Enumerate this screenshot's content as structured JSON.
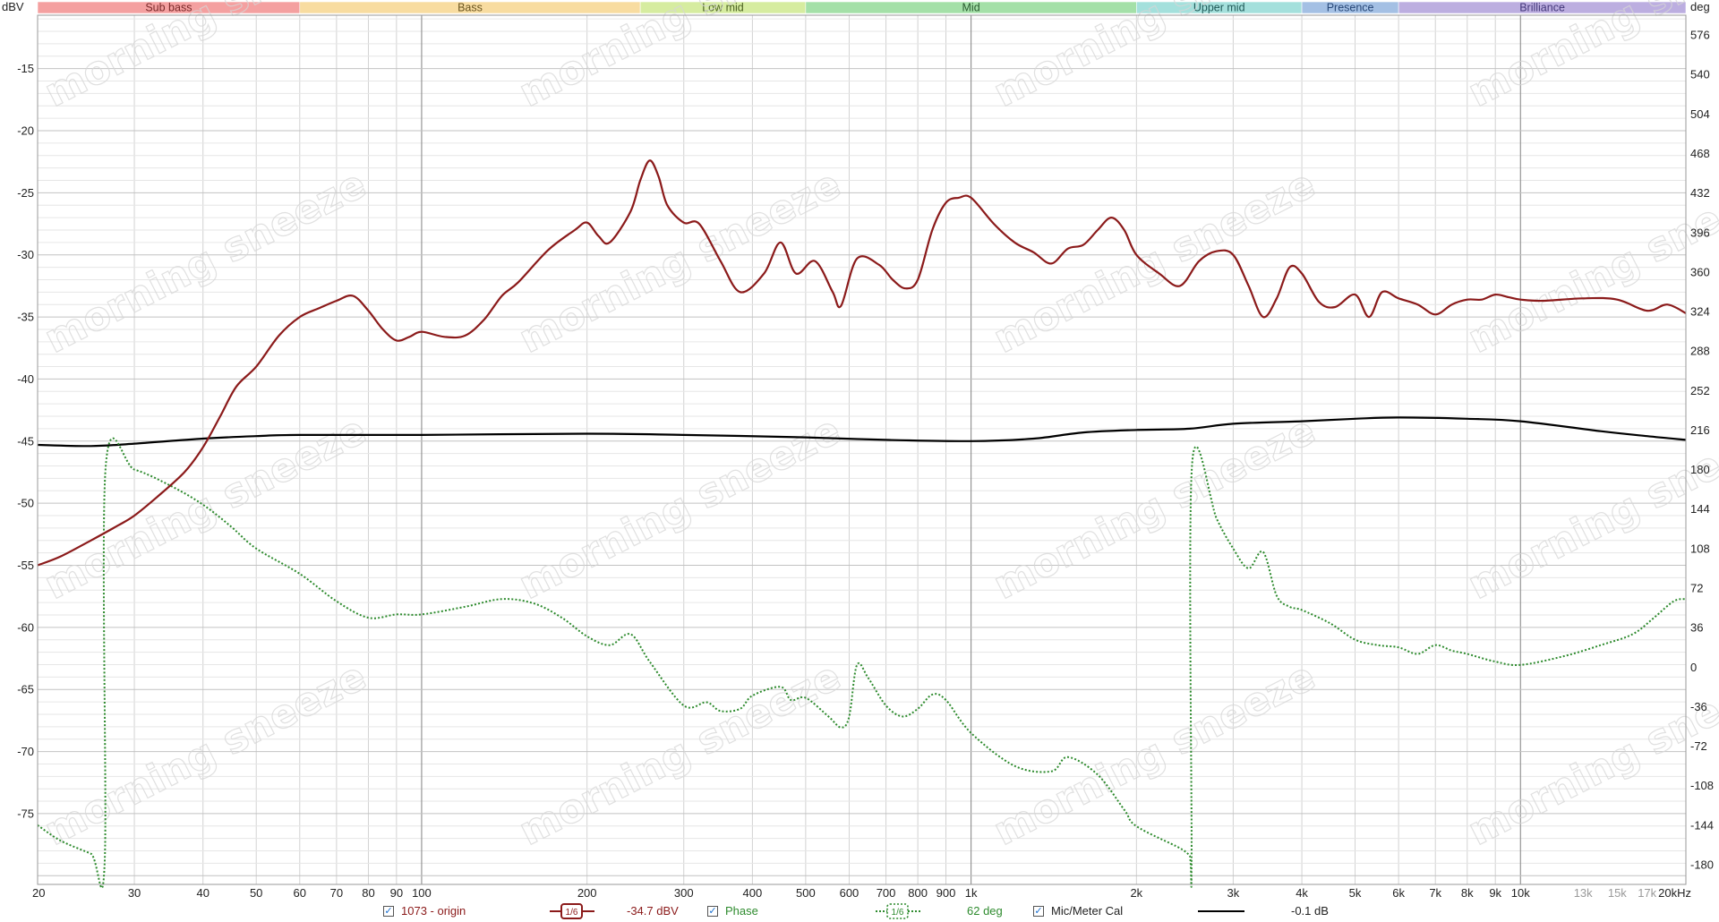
{
  "chart_data": {
    "type": "line",
    "x_scale": "log",
    "xlim": [
      20,
      20000
    ],
    "y_left": {
      "unit_label": "dBV",
      "lim": [
        -80.7,
        -10.7
      ],
      "ticks": [
        -15,
        -20,
        -25,
        -30,
        -35,
        -40,
        -45,
        -50,
        -55,
        -60,
        -65,
        -70,
        -75
      ]
    },
    "y_right": {
      "unit_label": "deg",
      "lim": [
        -198,
        594
      ],
      "ticks": [
        576,
        540,
        504,
        468,
        432,
        396,
        360,
        324,
        288,
        252,
        216,
        180,
        144,
        108,
        72,
        36,
        0,
        -36,
        -72,
        -108,
        -144,
        -180
      ]
    },
    "x_ticks_major": [
      {
        "v": 20,
        "t": "20"
      },
      {
        "v": 30,
        "t": "30"
      },
      {
        "v": 40,
        "t": "40"
      },
      {
        "v": 50,
        "t": "50"
      },
      {
        "v": 60,
        "t": "60"
      },
      {
        "v": 70,
        "t": "70"
      },
      {
        "v": 80,
        "t": "80"
      },
      {
        "v": 90,
        "t": "90"
      },
      {
        "v": 100,
        "t": "100"
      },
      {
        "v": 200,
        "t": "200"
      },
      {
        "v": 300,
        "t": "300"
      },
      {
        "v": 400,
        "t": "400"
      },
      {
        "v": 500,
        "t": "500"
      },
      {
        "v": 600,
        "t": "600"
      },
      {
        "v": 700,
        "t": "700"
      },
      {
        "v": 800,
        "t": "800"
      },
      {
        "v": 900,
        "t": "900"
      },
      {
        "v": 1000,
        "t": "1k"
      },
      {
        "v": 2000,
        "t": "2k"
      },
      {
        "v": 3000,
        "t": "3k"
      },
      {
        "v": 4000,
        "t": "4k"
      },
      {
        "v": 5000,
        "t": "5k"
      },
      {
        "v": 6000,
        "t": "6k"
      },
      {
        "v": 7000,
        "t": "7k"
      },
      {
        "v": 8000,
        "t": "8k"
      },
      {
        "v": 9000,
        "t": "9k"
      },
      {
        "v": 10000,
        "t": "10k"
      },
      {
        "v": 20000,
        "t": "20kHz"
      }
    ],
    "x_ticks_minor": [
      {
        "v": 13000,
        "t": "13k"
      },
      {
        "v": 15000,
        "t": "15k"
      },
      {
        "v": 17000,
        "t": "17k"
      }
    ],
    "bands": [
      {
        "name": "Sub bass",
        "from": 20,
        "to": 60,
        "color": "#f4a0a0",
        "text": "#7a2a2a"
      },
      {
        "name": "Bass",
        "from": 60,
        "to": 250,
        "color": "#f8dca0",
        "text": "#6a5520"
      },
      {
        "name": "Low mid",
        "from": 250,
        "to": 500,
        "color": "#d6eca0",
        "text": "#4a6020"
      },
      {
        "name": "Mid",
        "from": 500,
        "to": 2000,
        "color": "#a4e0a8",
        "text": "#2a5a30"
      },
      {
        "name": "Upper mid",
        "from": 2000,
        "to": 4000,
        "color": "#a4e0dc",
        "text": "#205a58"
      },
      {
        "name": "Presence",
        "from": 4000,
        "to": 6000,
        "color": "#a4c0e4",
        "text": "#284878"
      },
      {
        "name": "Brilliance",
        "from": 6000,
        "to": 20000,
        "color": "#bcaee0",
        "text": "#44387a"
      }
    ],
    "series": [
      {
        "name": "1073 - origin",
        "axis": "left",
        "color": "#8b1a1a",
        "style": "solid",
        "points": [
          [
            20,
            -55
          ],
          [
            22,
            -54.3
          ],
          [
            25,
            -53
          ],
          [
            28,
            -51.8
          ],
          [
            30,
            -51
          ],
          [
            33,
            -49.5
          ],
          [
            37,
            -47.5
          ],
          [
            40,
            -45.5
          ],
          [
            43,
            -43
          ],
          [
            46,
            -40.6
          ],
          [
            50,
            -39
          ],
          [
            55,
            -36.5
          ],
          [
            60,
            -35
          ],
          [
            65,
            -34.3
          ],
          [
            70,
            -33.7
          ],
          [
            75,
            -33.3
          ],
          [
            80,
            -34.5
          ],
          [
            85,
            -36
          ],
          [
            90,
            -36.9
          ],
          [
            95,
            -36.6
          ],
          [
            100,
            -36.2
          ],
          [
            110,
            -36.6
          ],
          [
            120,
            -36.5
          ],
          [
            130,
            -35.2
          ],
          [
            140,
            -33.3
          ],
          [
            150,
            -32.2
          ],
          [
            170,
            -29.6
          ],
          [
            190,
            -28
          ],
          [
            200,
            -27.4
          ],
          [
            210,
            -28.5
          ],
          [
            220,
            -29
          ],
          [
            240,
            -26.5
          ],
          [
            250,
            -24
          ],
          [
            260,
            -22.4
          ],
          [
            270,
            -23.7
          ],
          [
            280,
            -26
          ],
          [
            300,
            -27.4
          ],
          [
            320,
            -27.5
          ],
          [
            350,
            -30.5
          ],
          [
            380,
            -33
          ],
          [
            420,
            -31.5
          ],
          [
            450,
            -29
          ],
          [
            480,
            -31.5
          ],
          [
            520,
            -30.5
          ],
          [
            560,
            -33
          ],
          [
            580,
            -34.1
          ],
          [
            620,
            -30.3
          ],
          [
            680,
            -30.8
          ],
          [
            720,
            -32
          ],
          [
            760,
            -32.7
          ],
          [
            800,
            -32
          ],
          [
            850,
            -28
          ],
          [
            900,
            -25.8
          ],
          [
            950,
            -25.4
          ],
          [
            1000,
            -25.4
          ],
          [
            1100,
            -27.5
          ],
          [
            1200,
            -29
          ],
          [
            1300,
            -29.8
          ],
          [
            1400,
            -30.7
          ],
          [
            1500,
            -29.5
          ],
          [
            1600,
            -29.2
          ],
          [
            1700,
            -28
          ],
          [
            1800,
            -27
          ],
          [
            1900,
            -28
          ],
          [
            2000,
            -30
          ],
          [
            2200,
            -31.5
          ],
          [
            2400,
            -32.5
          ],
          [
            2600,
            -30.5
          ],
          [
            2800,
            -29.7
          ],
          [
            3000,
            -30
          ],
          [
            3200,
            -32.5
          ],
          [
            3400,
            -35
          ],
          [
            3600,
            -33.5
          ],
          [
            3800,
            -31
          ],
          [
            4000,
            -31.5
          ],
          [
            4300,
            -33.8
          ],
          [
            4600,
            -34.2
          ],
          [
            5000,
            -33.2
          ],
          [
            5300,
            -35
          ],
          [
            5600,
            -33
          ],
          [
            6000,
            -33.5
          ],
          [
            6500,
            -34
          ],
          [
            7000,
            -34.8
          ],
          [
            7500,
            -34
          ],
          [
            8000,
            -33.6
          ],
          [
            8500,
            -33.6
          ],
          [
            9000,
            -33.2
          ],
          [
            9500,
            -33.4
          ],
          [
            10000,
            -33.6
          ],
          [
            11000,
            -33.7
          ],
          [
            13000,
            -33.5
          ],
          [
            15000,
            -33.6
          ],
          [
            17000,
            -34.5
          ],
          [
            18500,
            -34.0
          ],
          [
            20000,
            -34.7
          ]
        ]
      },
      {
        "name": "Mic/Meter Cal",
        "axis": "left",
        "color": "#000000",
        "style": "solid",
        "points": [
          [
            20,
            -45.3
          ],
          [
            25,
            -45.4
          ],
          [
            30,
            -45.2
          ],
          [
            40,
            -44.8
          ],
          [
            50,
            -44.6
          ],
          [
            60,
            -44.5
          ],
          [
            100,
            -44.5
          ],
          [
            200,
            -44.4
          ],
          [
            300,
            -44.5
          ],
          [
            500,
            -44.7
          ],
          [
            700,
            -44.9
          ],
          [
            1000,
            -45
          ],
          [
            1300,
            -44.8
          ],
          [
            1600,
            -44.3
          ],
          [
            2000,
            -44.1
          ],
          [
            2500,
            -44.0
          ],
          [
            3000,
            -43.6
          ],
          [
            4000,
            -43.4
          ],
          [
            5000,
            -43.2
          ],
          [
            6000,
            -43.1
          ],
          [
            8000,
            -43.2
          ],
          [
            10000,
            -43.4
          ],
          [
            14000,
            -44.2
          ],
          [
            17000,
            -44.6
          ],
          [
            20000,
            -44.9
          ]
        ]
      },
      {
        "name": "Phase",
        "axis": "right",
        "color": "#2e8b2e",
        "style": "dotted",
        "points": [
          [
            20,
            -144
          ],
          [
            22,
            -158
          ],
          [
            25,
            -170
          ],
          [
            26.5,
            -176
          ],
          [
            26.6,
            182
          ],
          [
            30,
            180
          ],
          [
            35,
            165
          ],
          [
            40,
            148
          ],
          [
            45,
            128
          ],
          [
            50,
            108
          ],
          [
            60,
            85
          ],
          [
            70,
            60
          ],
          [
            80,
            45
          ],
          [
            90,
            48
          ],
          [
            100,
            48
          ],
          [
            120,
            55
          ],
          [
            140,
            62
          ],
          [
            160,
            58
          ],
          [
            180,
            45
          ],
          [
            200,
            28
          ],
          [
            220,
            20
          ],
          [
            240,
            30
          ],
          [
            260,
            5
          ],
          [
            300,
            -35
          ],
          [
            330,
            -32
          ],
          [
            350,
            -40
          ],
          [
            380,
            -38
          ],
          [
            400,
            -26
          ],
          [
            450,
            -18
          ],
          [
            470,
            -30
          ],
          [
            500,
            -28
          ],
          [
            550,
            -45
          ],
          [
            580,
            -55
          ],
          [
            600,
            -45
          ],
          [
            620,
            2
          ],
          [
            650,
            -10
          ],
          [
            700,
            -35
          ],
          [
            750,
            -45
          ],
          [
            800,
            -38
          ],
          [
            850,
            -25
          ],
          [
            900,
            -30
          ],
          [
            1000,
            -60
          ],
          [
            1200,
            -90
          ],
          [
            1400,
            -95
          ],
          [
            1500,
            -82
          ],
          [
            1700,
            -98
          ],
          [
            1900,
            -130
          ],
          [
            2000,
            -145
          ],
          [
            2400,
            -165
          ],
          [
            2500,
            -172
          ],
          [
            2520,
            -174
          ],
          [
            2525,
            185
          ],
          [
            2800,
            135
          ],
          [
            3000,
            108
          ],
          [
            3200,
            90
          ],
          [
            3400,
            105
          ],
          [
            3600,
            65
          ],
          [
            3800,
            55
          ],
          [
            4000,
            52
          ],
          [
            4500,
            40
          ],
          [
            5000,
            25
          ],
          [
            5500,
            20
          ],
          [
            6000,
            18
          ],
          [
            6500,
            12
          ],
          [
            7000,
            20
          ],
          [
            7500,
            15
          ],
          [
            8000,
            12
          ],
          [
            9000,
            5
          ],
          [
            10000,
            2
          ],
          [
            12000,
            10
          ],
          [
            14000,
            20
          ],
          [
            16000,
            30
          ],
          [
            17500,
            45
          ],
          [
            19000,
            60
          ],
          [
            20000,
            62
          ]
        ]
      }
    ],
    "legend": [
      {
        "series": "1073 - origin",
        "checked": true,
        "smoothing": "1/6",
        "readout": "-34.7 dBV",
        "color": "#8b1a1a"
      },
      {
        "series": "Phase",
        "checked": true,
        "smoothing": "1/6",
        "readout": "62 deg",
        "color": "#2e8b2e"
      },
      {
        "series": "Mic/Meter Cal",
        "checked": true,
        "smoothing": "",
        "readout": "-0.1 dB",
        "color": "#000000"
      }
    ],
    "watermark": "morning sneeze"
  },
  "legend_labels": {
    "series1_name": "1073 - origin",
    "series1_smoothing": "1/6",
    "series1_readout": "-34.7 dBV",
    "series2_name": "Phase",
    "series2_smoothing": "1/6",
    "series2_readout": "62 deg",
    "series3_name": "Mic/Meter Cal",
    "series3_readout": "-0.1 dB",
    "check_glyph": "✓"
  }
}
